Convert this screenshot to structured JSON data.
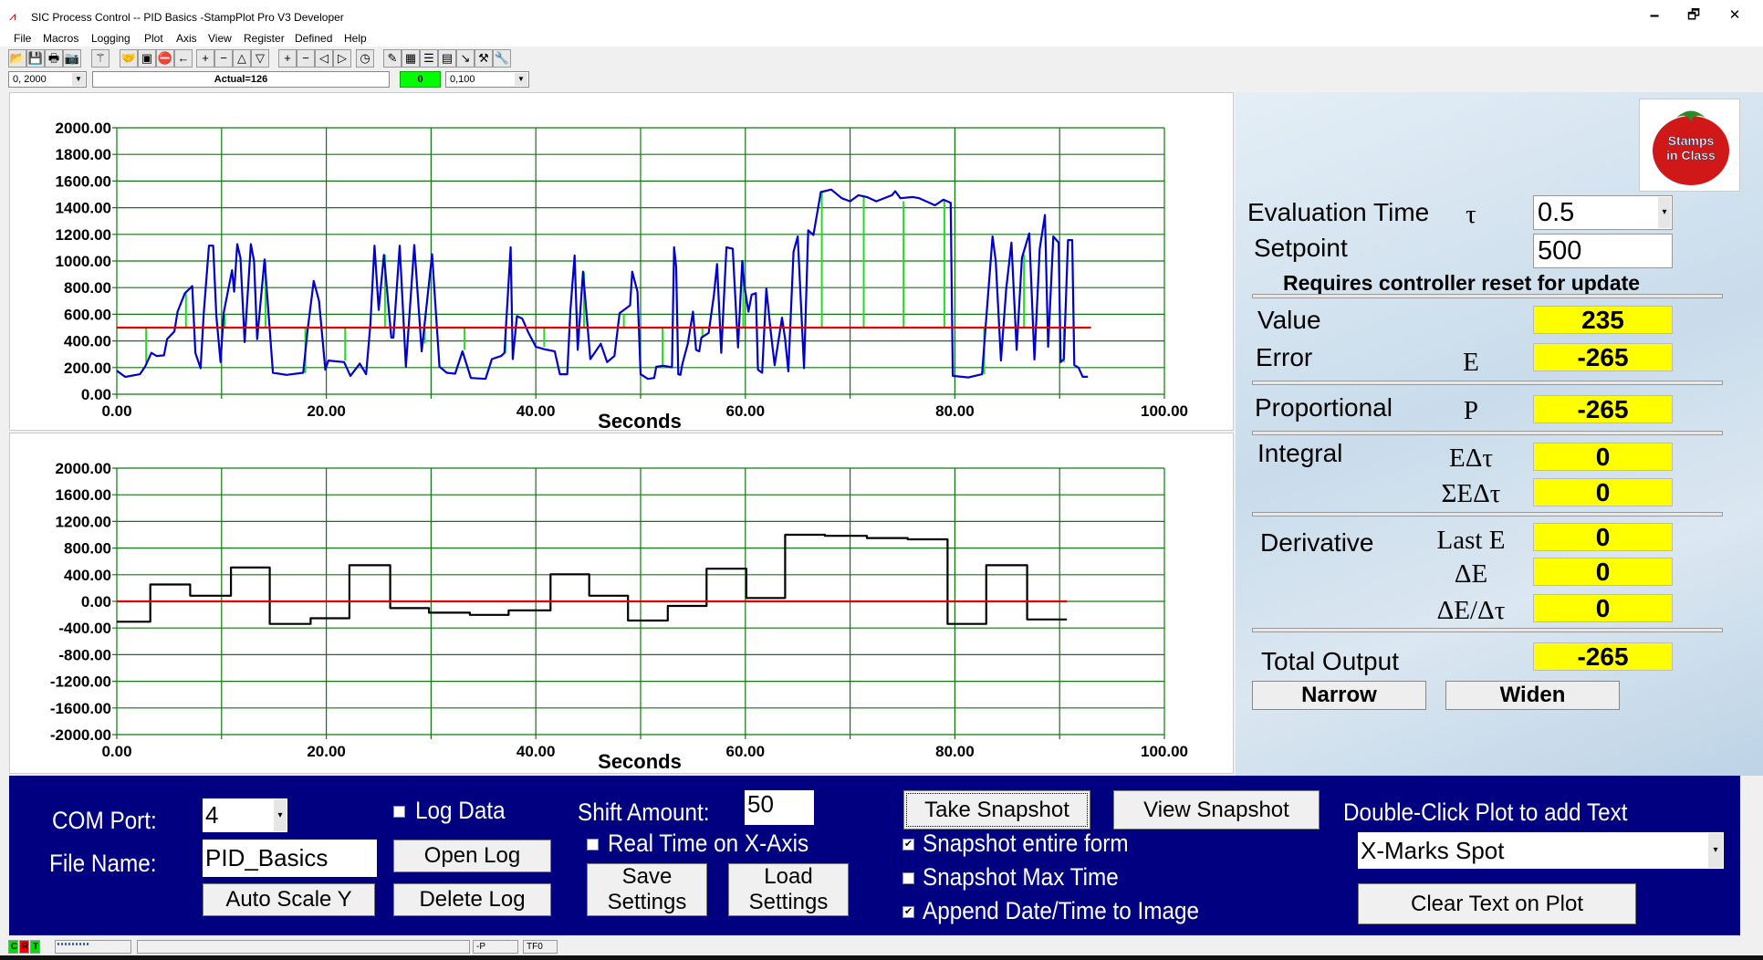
{
  "window": {
    "title": "SIC Process Control -- PID Basics -StampPlot Pro V3 Developer",
    "minimize": "🗕",
    "maximize": "🗗",
    "close": "✕"
  },
  "menu": [
    "File",
    "Macros",
    "Logging",
    "Plot",
    "Axis",
    "View",
    "Register",
    "Defined",
    "Help"
  ],
  "toolbar": {
    "icons": [
      "open-folder",
      "save",
      "print",
      "camera",
      "magic-wand",
      "handshake",
      "monitor",
      "stop",
      "arrow-left",
      "plus",
      "minus",
      "triangle-up",
      "triangle-down",
      "plus",
      "minus",
      "triangle-left",
      "triangle-right",
      "clock",
      "pen",
      "chart-grid",
      "note",
      "calculator",
      "probe",
      "hammer",
      "wrench"
    ],
    "y_range": "0, 2000",
    "status": "Actual=126",
    "indicator": "0",
    "indicator_color": "#00ff00",
    "x_range": "0,100"
  },
  "chart_data": [
    {
      "type": "line",
      "xlabel": "Seconds",
      "xlim": [
        0,
        100
      ],
      "ylim": [
        0,
        2000
      ],
      "grid": true,
      "xticks": [
        "0.00",
        "20.00",
        "40.00",
        "60.00",
        "80.00",
        "100.00"
      ],
      "yticks": [
        "2000.00",
        "1800.00",
        "1600.00",
        "1400.00",
        "1200.00",
        "1000.00",
        "800.00",
        "600.00",
        "400.00",
        "200.00",
        "0.00"
      ],
      "series": [
        {
          "color": "#0000cc",
          "points": [
            [
              0,
              177
            ],
            [
              0.8,
              130
            ],
            [
              2.2,
              150
            ],
            [
              2.7,
              207
            ],
            [
              3.3,
              310
            ],
            [
              3.8,
              287
            ],
            [
              4.5,
              292
            ],
            [
              4.8,
              414
            ],
            [
              5.5,
              471
            ],
            [
              5.8,
              620
            ],
            [
              6.5,
              758
            ],
            [
              7.2,
              811
            ],
            [
              7.5,
              310
            ],
            [
              8,
              195
            ],
            [
              8.3,
              609
            ],
            [
              8.8,
              1115
            ],
            [
              9.2,
              1115
            ],
            [
              9.5,
              586
            ],
            [
              9.9,
              241
            ],
            [
              10.2,
              609
            ],
            [
              11,
              931
            ],
            [
              11.2,
              770
            ],
            [
              11.5,
              1126
            ],
            [
              11.8,
              1023
            ],
            [
              12.2,
              391
            ],
            [
              12.8,
              1126
            ],
            [
              13.1,
              1000
            ],
            [
              13.4,
              414
            ],
            [
              14.1,
              1011
            ],
            [
              14.9,
              161
            ],
            [
              16.2,
              145
            ],
            [
              17.8,
              161
            ],
            [
              18.2,
              471
            ],
            [
              18.8,
              850
            ],
            [
              19.3,
              701
            ],
            [
              19.9,
              184
            ],
            [
              20.2,
              253
            ],
            [
              21.7,
              241
            ],
            [
              22.3,
              138
            ],
            [
              23.2,
              230
            ],
            [
              23.8,
              150
            ],
            [
              24.2,
              517
            ],
            [
              24.6,
              1115
            ],
            [
              25,
              632
            ],
            [
              25.5,
              1046
            ],
            [
              26.2,
              425
            ],
            [
              26.4,
              425
            ],
            [
              27,
              1115
            ],
            [
              27.6,
              207
            ],
            [
              28.4,
              1120
            ],
            [
              29.1,
              322
            ],
            [
              30.1,
              1051
            ],
            [
              30.8,
              207
            ],
            [
              31.5,
              161
            ],
            [
              32.3,
              154
            ],
            [
              33,
              322
            ],
            [
              33.8,
              122
            ],
            [
              35.2,
              115
            ],
            [
              35.8,
              264
            ],
            [
              36.7,
              287
            ],
            [
              37,
              310
            ],
            [
              37.6,
              1103
            ],
            [
              37.8,
              264
            ],
            [
              38.2,
              586
            ],
            [
              38.7,
              568
            ],
            [
              39.3,
              460
            ],
            [
              40,
              356
            ],
            [
              40.8,
              338
            ],
            [
              41.8,
              322
            ],
            [
              42.3,
              150
            ],
            [
              43,
              150
            ],
            [
              43.3,
              632
            ],
            [
              43.7,
              1041
            ],
            [
              44,
              333
            ],
            [
              44.5,
              920
            ],
            [
              45.2,
              264
            ],
            [
              46.2,
              379
            ],
            [
              46.8,
              241
            ],
            [
              47.5,
              287
            ],
            [
              48,
              609
            ],
            [
              49,
              667
            ],
            [
              49.2,
              920
            ],
            [
              49.7,
              770
            ],
            [
              50,
              150
            ],
            [
              50.7,
              115
            ],
            [
              51.3,
              122
            ],
            [
              51.5,
              207
            ],
            [
              52.2,
              214
            ],
            [
              53,
              202
            ],
            [
              53.2,
              1103
            ],
            [
              53.4,
              954
            ],
            [
              53.6,
              150
            ],
            [
              53.8,
              145
            ],
            [
              54,
              230
            ],
            [
              54.5,
              379
            ],
            [
              55,
              620
            ],
            [
              55.3,
              333
            ],
            [
              55.6,
              322
            ],
            [
              55.8,
              425
            ],
            [
              56.5,
              460
            ],
            [
              57,
              747
            ],
            [
              57.3,
              977
            ],
            [
              57.7,
              310
            ],
            [
              58.2,
              1103
            ],
            [
              58.8,
              1092
            ],
            [
              59.1,
              632
            ],
            [
              59.3,
              351
            ],
            [
              59.7,
              1000
            ],
            [
              59.9,
              816
            ],
            [
              60.3,
              620
            ],
            [
              60.6,
              747
            ],
            [
              61,
              758
            ],
            [
              61.2,
              184
            ],
            [
              61.6,
              161
            ],
            [
              62,
              793
            ],
            [
              62.4,
              483
            ],
            [
              62.8,
              218
            ],
            [
              63.5,
              575
            ],
            [
              63.8,
              414
            ],
            [
              64.1,
              172
            ],
            [
              64.6,
              1069
            ],
            [
              65,
              1184
            ],
            [
              65.6,
              195
            ],
            [
              66,
              1230
            ],
            [
              66.5,
              1195
            ],
            [
              67.2,
              1517
            ],
            [
              68.2,
              1536
            ],
            [
              69.2,
              1471
            ],
            [
              70,
              1448
            ],
            [
              70.8,
              1494
            ],
            [
              71.6,
              1480
            ],
            [
              72.5,
              1448
            ],
            [
              74,
              1494
            ],
            [
              74.3,
              1524
            ],
            [
              74.8,
              1471
            ],
            [
              76,
              1480
            ],
            [
              76.6,
              1471
            ],
            [
              78.1,
              1418
            ],
            [
              78.9,
              1460
            ],
            [
              79.6,
              1437
            ],
            [
              79.8,
              138
            ],
            [
              81.3,
              126
            ],
            [
              82.6,
              150
            ],
            [
              82.9,
              471
            ],
            [
              83.6,
              1184
            ],
            [
              83.9,
              1000
            ],
            [
              84.4,
              253
            ],
            [
              84.9,
              793
            ],
            [
              85.4,
              1138
            ],
            [
              85.9,
              333
            ],
            [
              86.4,
              1023
            ],
            [
              87.1,
              1207
            ],
            [
              87.6,
              260
            ],
            [
              88.1,
              1092
            ],
            [
              88.6,
              1345
            ],
            [
              88.9,
              356
            ],
            [
              89.4,
              1184
            ],
            [
              89.9,
              1138
            ],
            [
              90.1,
              241
            ],
            [
              90.4,
              264
            ],
            [
              90.8,
              1157
            ],
            [
              91.2,
              1157
            ],
            [
              91.4,
              218
            ],
            [
              91.8,
              200
            ],
            [
              92.2,
              131
            ],
            [
              92.7,
              131
            ]
          ]
        },
        {
          "color": "#dd0000",
          "points": [
            [
              0,
              500
            ],
            [
              93,
              500
            ]
          ]
        }
      ],
      "stems": {
        "color": "#22dd22",
        "baseline": 500,
        "points": [
          [
            2.8,
            240
          ],
          [
            6.6,
            760
          ],
          [
            10.3,
            600
          ],
          [
            14.2,
            1010
          ],
          [
            18,
            160
          ],
          [
            21.8,
            253
          ],
          [
            25.6,
            1050
          ],
          [
            29.4,
            380
          ],
          [
            33.2,
            333
          ],
          [
            37.1,
            310
          ],
          [
            40.8,
            356
          ],
          [
            44.6,
            920
          ],
          [
            48.4,
            600
          ],
          [
            52.1,
            218
          ],
          [
            55.9,
            437
          ],
          [
            59.8,
            1007
          ],
          [
            63.5,
            568
          ],
          [
            67.3,
            1517
          ],
          [
            71.3,
            1494
          ],
          [
            75.1,
            1448
          ],
          [
            79,
            1448
          ],
          [
            82.8,
            150
          ],
          [
            86.6,
            1050
          ],
          [
            90.4,
            241
          ]
        ]
      }
    },
    {
      "type": "line",
      "xlabel": "Seconds",
      "xlim": [
        0,
        100
      ],
      "ylim": [
        -2000,
        2000
      ],
      "grid": true,
      "xticks": [
        "0.00",
        "20.00",
        "40.00",
        "60.00",
        "80.00",
        "100.00"
      ],
      "yticks": [
        "2000.00",
        "1600.00",
        "1200.00",
        "800.00",
        "400.00",
        "0.00",
        "-400.00",
        "-800.00",
        "-1200.00",
        "-1600.00",
        "-2000.00"
      ],
      "series": [
        {
          "color": "#000000",
          "step": "after",
          "points": [
            [
              0,
              -305
            ],
            [
              3.2,
              254
            ],
            [
              7,
              85
            ],
            [
              10.9,
              508
            ],
            [
              14.6,
              -339
            ],
            [
              18.5,
              -254
            ],
            [
              22.2,
              542
            ],
            [
              26.1,
              -102
            ],
            [
              29.8,
              -170
            ],
            [
              33.7,
              -203
            ],
            [
              37.4,
              -136
            ],
            [
              41.4,
              407
            ],
            [
              45.1,
              85
            ],
            [
              48.8,
              -288
            ],
            [
              52.6,
              -68
            ],
            [
              56.3,
              491
            ],
            [
              60.1,
              51
            ],
            [
              63.8,
              1000
            ],
            [
              67.6,
              983
            ],
            [
              71.6,
              950
            ],
            [
              75.5,
              932
            ],
            [
              79.3,
              -339
            ],
            [
              83,
              542
            ],
            [
              86.9,
              -271
            ],
            [
              90.7,
              -271
            ]
          ]
        },
        {
          "color": "#dd0000",
          "points": [
            [
              0,
              0
            ],
            [
              90.7,
              0
            ]
          ]
        }
      ]
    }
  ],
  "panel": {
    "logo_text": "Stamps in Class",
    "eval_label": "Evaluation Time",
    "eval_symbol": "τ",
    "eval_value": "0.5",
    "setpoint_label": "Setpoint",
    "setpoint_value": "500",
    "reset_note": "Requires controller reset for update",
    "value_label": "Value",
    "value": "235",
    "error_label": "Error",
    "error_symbol": "E",
    "error": "-265",
    "prop_label": "Proportional",
    "prop_symbol": "P",
    "prop": "-265",
    "integral_label": "Integral",
    "int_sym1": "EΔτ",
    "int_val1": "0",
    "int_sym2": "ΣEΔτ",
    "int_val2": "0",
    "deriv_label": "Derivative",
    "der_sym1": "Last E",
    "der_val1": "0",
    "der_sym2": "ΔE",
    "der_val2": "0",
    "der_sym3": "ΔE/Δτ",
    "der_val3": "0",
    "total_label": "Total Output",
    "total": "-265",
    "narrow": "Narrow",
    "widen": "Widen"
  },
  "controls": {
    "com_label": "COM Port:",
    "com_value": "4",
    "file_label": "File Name:",
    "file_value": "PID_Basics",
    "auto_scale": "Auto Scale Y",
    "log_data": "Log Data",
    "log_data_checked": false,
    "open_log": "Open Log",
    "delete_log": "Delete Log",
    "shift_label": "Shift Amount:",
    "shift_value": "50",
    "real_time": "Real Time on X-Axis",
    "real_time_checked": false,
    "save_settings": "Save Settings",
    "load_settings": "Load Settings",
    "take_snapshot": "Take Snapshot",
    "view_snapshot": "View Snapshot",
    "snap_entire": "Snapshot entire form",
    "snap_entire_checked": true,
    "snap_max": "Snapshot Max Time",
    "snap_max_checked": false,
    "append_date": "Append Date/Time to Image",
    "append_date_checked": true,
    "dblclick_label": "Double-Click Plot to add Text",
    "text_select": "X-Marks Spot",
    "clear_text": "Clear Text on Plot"
  },
  "status_bar": {
    "c": "C",
    "r": "R",
    "t": "T",
    "field2": "-P",
    "field3": "TF0",
    "c_color": "#00dd00",
    "r_color": "#ee0000",
    "t_color": "#00dd00"
  }
}
